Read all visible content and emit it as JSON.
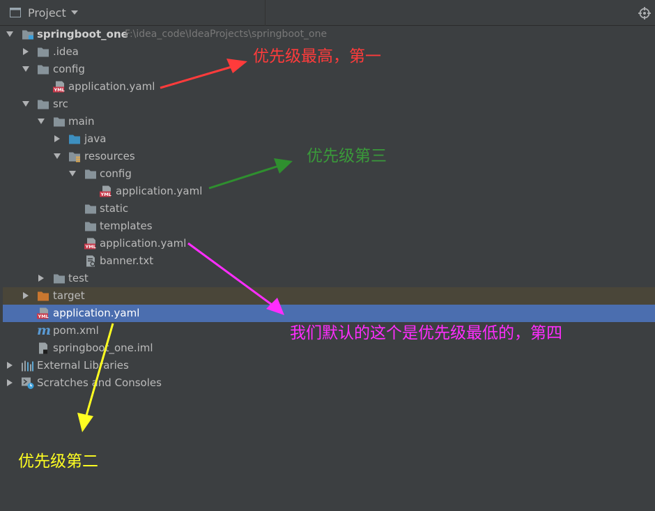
{
  "panel": {
    "title": "Project"
  },
  "tree": {
    "root_name": "springboot_one",
    "root_path": "F:\\idea_code\\IdeaProjects\\springboot_one",
    "items": [
      {
        "label": ".idea"
      },
      {
        "label": "config"
      },
      {
        "label": "application.yaml"
      },
      {
        "label": "src"
      },
      {
        "label": "main"
      },
      {
        "label": "java"
      },
      {
        "label": "resources"
      },
      {
        "label": "config"
      },
      {
        "label": "application.yaml"
      },
      {
        "label": "static"
      },
      {
        "label": "templates"
      },
      {
        "label": "application.yaml"
      },
      {
        "label": "banner.txt"
      },
      {
        "label": "test"
      },
      {
        "label": "target"
      },
      {
        "label": "application.yaml"
      },
      {
        "label": "pom.xml"
      },
      {
        "label": "springboot_one.iml"
      },
      {
        "label": "External Libraries"
      },
      {
        "label": "Scratches and Consoles"
      }
    ]
  },
  "annotations": {
    "first": {
      "text": "优先级最高，第一",
      "color": "#ff3b3b"
    },
    "third": {
      "text": "优先级第三",
      "color": "#3a9a3a"
    },
    "fourth": {
      "text": "我们默认的这个是优先级最低的，第四",
      "color": "#ff2dff"
    },
    "second": {
      "text": "优先级第二",
      "color": "#ffff22"
    }
  },
  "colors": {
    "background": "#3c3f41",
    "selection": "#4b6eaf",
    "folder": "#87939a",
    "source_folder": "#3d8fbf",
    "excluded_folder": "#c9772f"
  }
}
